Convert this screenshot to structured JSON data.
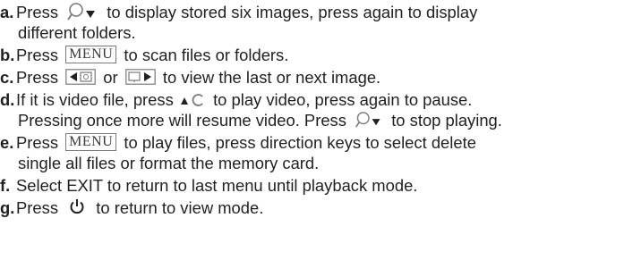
{
  "steps": [
    {
      "letter": "a.",
      "segments": [
        "Press",
        "to display stored six images, press again to display"
      ],
      "cont": "different folders."
    },
    {
      "letter": "b.",
      "segments": [
        "Press",
        "to scan files or folders."
      ],
      "menu_label": "MENU"
    },
    {
      "letter": "c.",
      "segments": [
        "Press",
        "or",
        "to view the last or next image."
      ]
    },
    {
      "letter": "d.",
      "segments": [
        "If it is video file, press",
        "to play video, press again to pause."
      ],
      "cont_segments": [
        "Pressing once more will resume video. Press",
        "to stop playing."
      ]
    },
    {
      "letter": "e.",
      "segments": [
        "Press",
        "to play files, press direction keys to select delete"
      ],
      "menu_label": "MENU",
      "cont": "single all files or format the memory card."
    },
    {
      "letter": "f.",
      "text": "Select EXIT to return to last menu until playback mode."
    },
    {
      "letter": "g.",
      "segments": [
        "Press",
        "to return to view mode."
      ]
    }
  ],
  "icons": {
    "zoom": "zoom-down-icon",
    "menu": "menu-button-icon",
    "prev": "prev-image-icon",
    "next": "next-image-icon",
    "play": "play-rotate-icon",
    "power": "power-icon"
  }
}
